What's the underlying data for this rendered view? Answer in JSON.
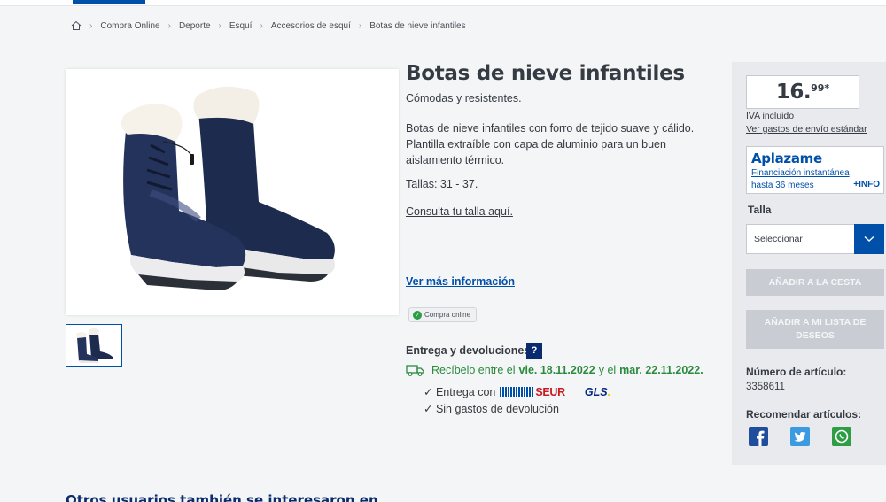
{
  "breadcrumb": {
    "items": [
      "Compra Online",
      "Deporte",
      "Esquí",
      "Accesorios de esquí",
      "Botas de nieve infantiles"
    ]
  },
  "product": {
    "title": "Botas de nieve infantiles",
    "subtitle": "Cómodas y resistentes.",
    "description": "Botas de nieve infantiles con forro de tejido suave y cálido. Plantilla extraíble con capa de aluminio para un buen aislamiento térmico.",
    "sizes": "Tallas: 31 - 37.",
    "size_link": "Consulta tu talla aquí.",
    "more_info": "Ver más información",
    "online_badge": "Compra online"
  },
  "delivery": {
    "label": "Entrega y devoluciones:",
    "help": "?",
    "receive_prefix": "Recíbelo entre el",
    "date_from": "vie. 18.11.2022",
    "and": "y el",
    "date_to": "mar. 22.11.2022.",
    "carrier_label": "✓ Entrega con",
    "carrier_1": "SEUR",
    "carrier_2": "GLS",
    "returns": "✓ Sin gastos de devolución"
  },
  "sidebar": {
    "price_main": "16.",
    "price_cents": "99*",
    "vat": "IVA incluido",
    "shipping": "Ver gastos de envío estándar",
    "aplazame": {
      "logo": "Aplazame",
      "line1": "Financiación instantánea",
      "line2": "hasta 36 meses",
      "info": "+INFO"
    },
    "size_label": "Talla",
    "size_select": "Seleccionar",
    "add_to_cart": "Añadir a la cesta",
    "add_to_wishlist": "Añadir a mi lista de deseos",
    "article_label": "Número de artículo:",
    "article_number": "3358611",
    "recommend_label": "Recomendar artículos:"
  },
  "others_heading": "Otros usuarios también se interesaron en",
  "icons": {
    "home": "home-icon",
    "facebook": "facebook-icon",
    "twitter": "twitter-icon",
    "whatsapp": "whatsapp-icon",
    "truck": "truck-icon",
    "chevron": "chevron-down-icon"
  },
  "colors": {
    "brand_blue": "#0050aa",
    "delivery_green": "#2a8a3e",
    "disabled_button": "#c9cdd3",
    "facebook": "#1f4f9c",
    "twitter": "#3a9be0",
    "whatsapp": "#2e9d44"
  }
}
